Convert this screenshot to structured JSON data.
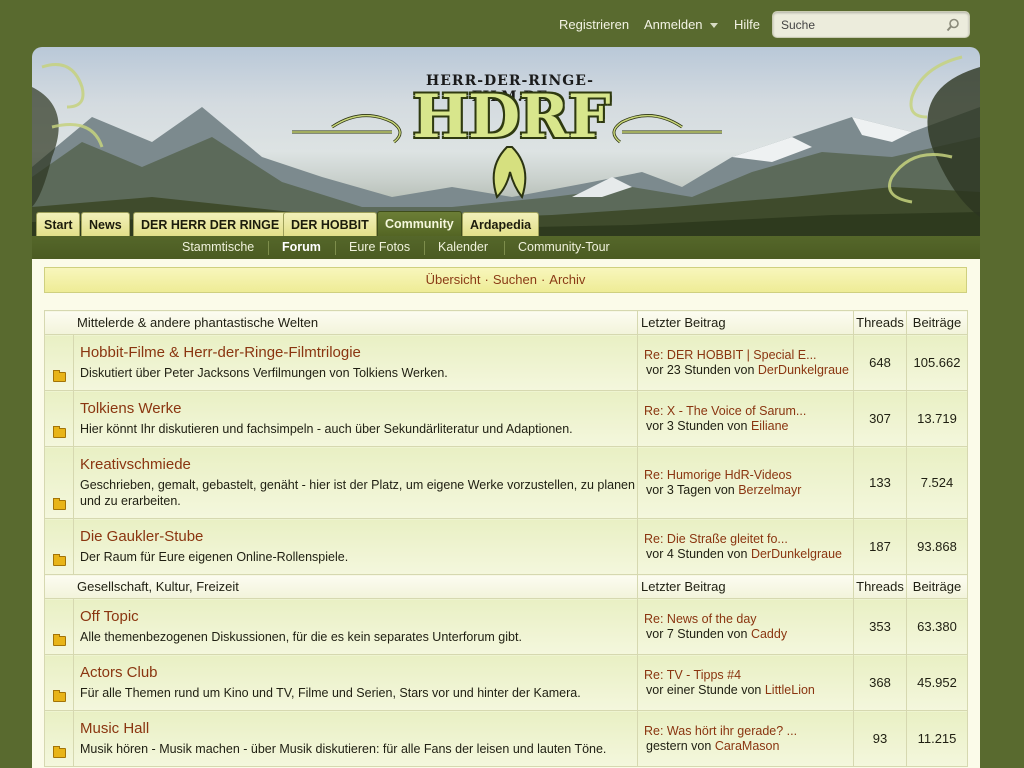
{
  "topbar": {
    "register": "Registrieren",
    "login": "Anmelden",
    "help": "Hilfe",
    "search_placeholder": "Suche"
  },
  "header": {
    "logo_small": "HERR-DER-RINGE-FILM.DE",
    "logo_big": "HDRF"
  },
  "tabs": [
    {
      "label": "Start",
      "active": false
    },
    {
      "label": "News",
      "active": false
    },
    {
      "label": "DER HERR DER RINGE",
      "active": false
    },
    {
      "label": "DER HOBBIT",
      "active": false
    },
    {
      "label": "Community",
      "active": true
    },
    {
      "label": "Ardapedia",
      "active": false
    }
  ],
  "subnav": [
    {
      "label": "Stammtische",
      "active": false
    },
    {
      "label": "Forum",
      "active": true
    },
    {
      "label": "Eure Fotos",
      "active": false
    },
    {
      "label": "Kalender",
      "active": false
    },
    {
      "label": "Community-Tour",
      "active": false
    }
  ],
  "pagebar": {
    "overview": "Übersicht",
    "search": "Suchen",
    "archive": "Archiv",
    "separator": "·"
  },
  "categories": [
    {
      "title": "Mittelerde & andere phantastische Welten",
      "last_header": "Letzter Beitrag",
      "threads_header": "Threads",
      "posts_header": "Beiträge",
      "forums": [
        {
          "name": "Hobbit-Filme & Herr-der-Ringe-Filmtrilogie",
          "desc": "Diskutiert über Peter Jacksons Verfilmungen von Tolkiens Werken.",
          "last_title": "Re: DER HOBBIT | Special E...",
          "last_when": "vor 23 Stunden von",
          "last_user": "DerDunkelgraue",
          "threads": "648",
          "posts": "105.662"
        },
        {
          "name": "Tolkiens Werke",
          "desc": "Hier könnt Ihr diskutieren und fachsimpeln - auch über Sekundärliteratur und Adaptionen.",
          "last_title": "Re: X - The Voice of Sarum...",
          "last_when": "vor 3 Stunden von",
          "last_user": "Eiliane",
          "threads": "307",
          "posts": "13.719"
        },
        {
          "name": "Kreativschmiede",
          "desc": "Geschrieben, gemalt, gebastelt, genäht - hier ist der Platz, um eigene Werke vorzustellen, zu planen und zu erarbeiten.",
          "last_title": "Re: Humorige HdR-Videos",
          "last_when": "vor 3 Tagen von",
          "last_user": "Berzelmayr",
          "threads": "133",
          "posts": "7.524"
        },
        {
          "name": "Die Gaukler-Stube",
          "desc": "Der Raum für Eure eigenen Online-Rollenspiele.",
          "last_title": "Re: Die Straße gleitet fo...",
          "last_when": "vor 4 Stunden von",
          "last_user": "DerDunkelgraue",
          "threads": "187",
          "posts": "93.868"
        }
      ]
    },
    {
      "title": "Gesellschaft, Kultur, Freizeit",
      "last_header": "Letzter Beitrag",
      "threads_header": "Threads",
      "posts_header": "Beiträge",
      "forums": [
        {
          "name": "Off Topic",
          "desc": "Alle themenbezogenen Diskussionen, für die es kein separates Unterforum gibt.",
          "last_title": "Re: News of the day",
          "last_when": "vor 7 Stunden von",
          "last_user": "Caddy",
          "threads": "353",
          "posts": "63.380"
        },
        {
          "name": "Actors Club",
          "desc": "Für alle Themen rund um Kino und TV, Filme und Serien, Stars vor und hinter der Kamera.",
          "last_title": "Re: TV - Tipps #4",
          "last_when": "vor einer Stunde von",
          "last_user": "LittleLion",
          "threads": "368",
          "posts": "45.952"
        },
        {
          "name": "Music Hall",
          "desc": "Musik hören - Musik machen - über Musik diskutieren: für alle Fans der leisen und lauten Töne.",
          "last_title": "Re: Was hört ihr gerade? ...",
          "last_when": "gestern von",
          "last_user": "CaraMason",
          "threads": "93",
          "posts": "11.215"
        }
      ]
    }
  ]
}
